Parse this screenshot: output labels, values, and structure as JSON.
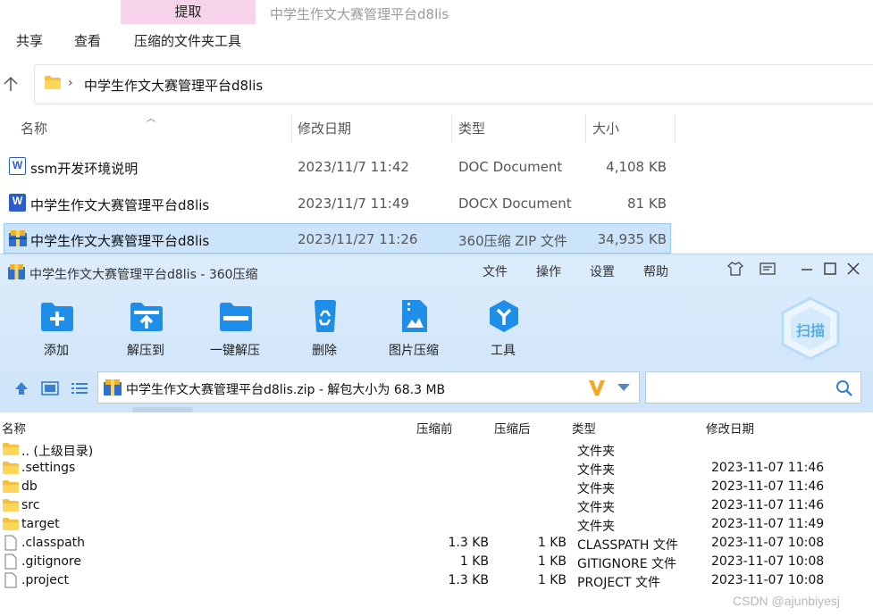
{
  "explorer": {
    "extract_tab": "提取",
    "window_title": "中学生作文大赛管理平台d8lis",
    "ribbon_tabs": [
      "共享",
      "查看",
      "压缩的文件夹工具"
    ],
    "address": "中学生作文大赛管理平台d8lis",
    "columns": [
      "名称",
      "修改日期",
      "类型",
      "大小"
    ],
    "files": [
      {
        "name": "ssm开发环境说明",
        "date": "2023/11/7 11:42",
        "type": "DOC Document",
        "size": "4,108 KB",
        "icon": "word-doc-icon"
      },
      {
        "name": "中学生作文大赛管理平台d8lis",
        "date": "2023/11/7 11:49",
        "type": "DOCX Document",
        "size": "81 KB",
        "icon": "word-docx-icon"
      },
      {
        "name": "中学生作文大赛管理平台d8lis",
        "date": "2023/11/27 11:26",
        "type": "360压缩 ZIP 文件",
        "size": "34,935 KB",
        "icon": "zip-archive-icon"
      }
    ]
  },
  "zip_app": {
    "title": "中学生作文大赛管理平台d8lis - 360压缩",
    "menu": [
      "文件",
      "操作",
      "设置",
      "帮助"
    ],
    "toolbar": [
      "添加",
      "解压到",
      "一键解压",
      "删除",
      "图片压缩",
      "工具"
    ],
    "scan_label": "扫描",
    "path": "中学生作文大赛管理平台d8lis.zip - 解包大小为 68.3 MB",
    "columns": [
      "名称",
      "压缩前",
      "压缩后",
      "类型",
      "修改日期"
    ],
    "rows": [
      {
        "name": ".. (上级目录)",
        "before": "",
        "after": "",
        "type": "文件夹",
        "date": "",
        "kind": "folder"
      },
      {
        "name": ".settings",
        "before": "",
        "after": "",
        "type": "文件夹",
        "date": "2023-11-07 11:46",
        "kind": "folder"
      },
      {
        "name": "db",
        "before": "",
        "after": "",
        "type": "文件夹",
        "date": "2023-11-07 11:46",
        "kind": "folder"
      },
      {
        "name": "src",
        "before": "",
        "after": "",
        "type": "文件夹",
        "date": "2023-11-07 11:46",
        "kind": "folder"
      },
      {
        "name": "target",
        "before": "",
        "after": "",
        "type": "文件夹",
        "date": "2023-11-07 11:49",
        "kind": "folder"
      },
      {
        "name": ".classpath",
        "before": "1.3 KB",
        "after": "1 KB",
        "type": "CLASSPATH 文件",
        "date": "2023-11-07 10:08",
        "kind": "file"
      },
      {
        "name": ".gitignore",
        "before": "1 KB",
        "after": "1 KB",
        "type": "GITIGNORE 文件",
        "date": "2023-11-07 10:08",
        "kind": "file"
      },
      {
        "name": ".project",
        "before": "1.3 KB",
        "after": "1 KB",
        "type": "PROJECT 文件",
        "date": "2023-11-07 10:08",
        "kind": "file"
      }
    ]
  },
  "watermark": "CSDN @ajunbiyesj",
  "colors": {
    "accent": "#1f8ee8",
    "selection": "#cce4fa",
    "word_blue": "#2b5cc9",
    "folder": "#f5c13c"
  }
}
